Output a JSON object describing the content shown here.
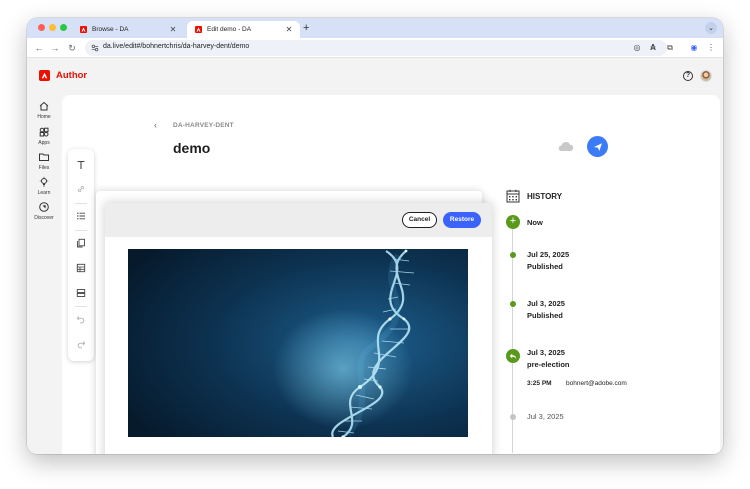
{
  "browser": {
    "tabs": [
      {
        "title": "Browse - DA",
        "active": false
      },
      {
        "title": "Edit demo - DA",
        "active": true
      }
    ],
    "url": "da.live/edit#/bohnertchris/da-harvey-dent/demo",
    "traffic_colors": [
      "#ff5f57",
      "#febc2e",
      "#28c840"
    ]
  },
  "app": {
    "brand": "Author",
    "brand_color": "#eb1000",
    "rail": [
      {
        "label": "Home",
        "icon": "home-icon"
      },
      {
        "label": "Apps",
        "icon": "apps-icon"
      },
      {
        "label": "Files",
        "icon": "folder-icon"
      },
      {
        "label": "Learn",
        "icon": "lightbulb-icon"
      },
      {
        "label": "Discover",
        "icon": "compass-icon"
      }
    ]
  },
  "document": {
    "breadcrumb": "DA-HARVEY-DENT",
    "title": "demo"
  },
  "preview": {
    "cancel_label": "Cancel",
    "restore_label": "Restore",
    "restore_color": "#3b63fb"
  },
  "history": {
    "title": "HISTORY",
    "now": "Now",
    "entries": [
      {
        "date": "Jul 25, 2025",
        "label": "Published"
      },
      {
        "date": "Jul 3, 2025",
        "label": "Published"
      },
      {
        "date": "Jul 3, 2025",
        "label": "pre-election",
        "time": "3:25 PM",
        "user": "bohnert@adobe.com"
      },
      {
        "date": "Jul 3, 2025"
      }
    ],
    "accent_color": "#5a9a1b"
  }
}
